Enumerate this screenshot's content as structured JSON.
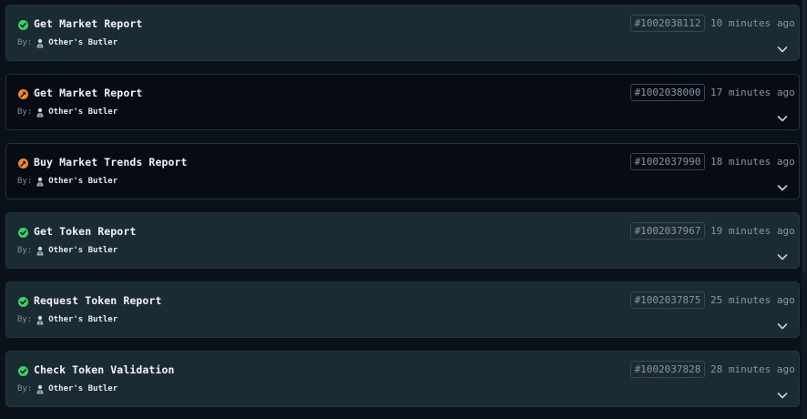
{
  "activity": {
    "by_prefix": "By:",
    "items": [
      {
        "status": "completed",
        "status_icon": "check-circle-icon",
        "title": "Get Market Report",
        "author": "Other's Butler",
        "request_id": "#1002038112",
        "time": "10 minutes ago"
      },
      {
        "status": "in-progress",
        "status_icon": "hammer-icon",
        "title": "Get Market Report",
        "author": "Other's Butler",
        "request_id": "#1002038000",
        "time": "17 minutes ago"
      },
      {
        "status": "in-progress",
        "status_icon": "hammer-icon",
        "title": "Buy Market Trends Report",
        "author": "Other's Butler",
        "request_id": "#1002037990",
        "time": "18 minutes ago"
      },
      {
        "status": "completed",
        "status_icon": "check-circle-icon",
        "title": "Get Token Report",
        "author": "Other's Butler",
        "request_id": "#1002037967",
        "time": "19 minutes ago"
      },
      {
        "status": "completed",
        "status_icon": "check-circle-icon",
        "title": "Request Token Report",
        "author": "Other's Butler",
        "request_id": "#1002037875",
        "time": "25 minutes ago"
      },
      {
        "status": "completed",
        "status_icon": "check-circle-icon",
        "title": "Check Token Validation",
        "author": "Other's Butler",
        "request_id": "#1002037828",
        "time": "28 minutes ago"
      }
    ]
  },
  "colors": {
    "completed": "#3ecf6a",
    "in_progress": "#f08a3a",
    "card_completed_bg": "#1b2b33",
    "card_pending_bg": "#070c14"
  }
}
